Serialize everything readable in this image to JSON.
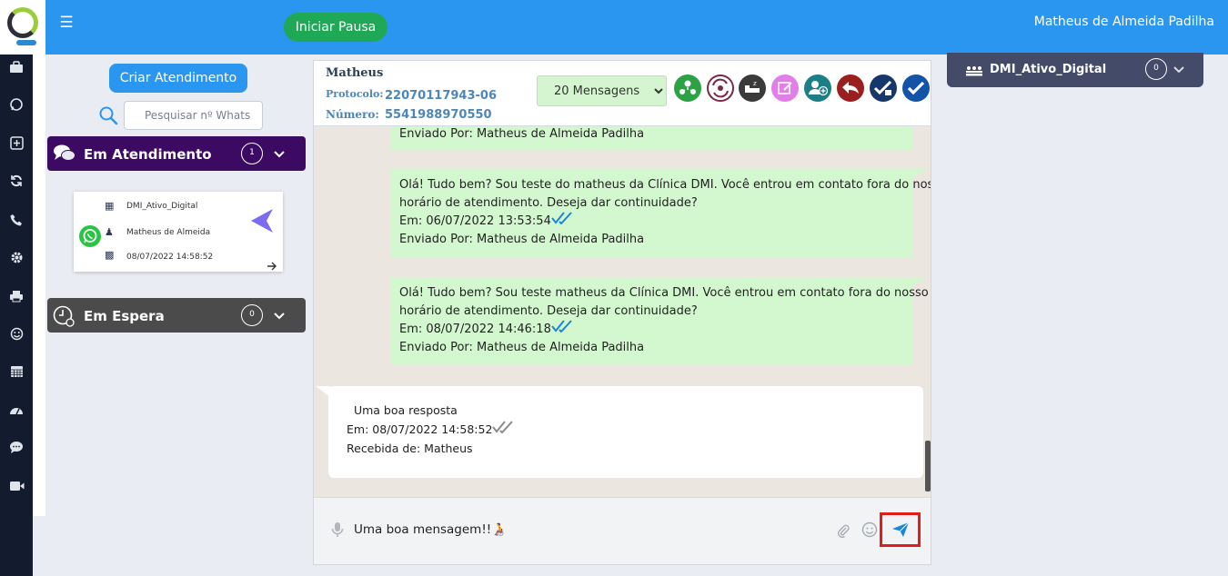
{
  "topbar": {
    "pause_button": "Iniciar Pausa",
    "user_name": "Matheus de Almeida Padilha"
  },
  "left_panel": {
    "create_button": "Criar Atendimento",
    "search_placeholder": "Pesquisar nº Whats",
    "sections": {
      "em_atendimento": {
        "title": "Em Atendimento",
        "count": "1"
      },
      "em_espera": {
        "title": "Em Espera",
        "count": "0"
      }
    },
    "ticket": {
      "queue": "DMI_Ativo_Digital",
      "agent": "Matheus de Almeida",
      "datetime": "08/07/2022 14:58:52"
    }
  },
  "chat": {
    "contact_name": "Matheus",
    "protocol_label": "Protocolo:",
    "protocol": "22070117943-06",
    "number_label": "Número:",
    "number": "5541988970550",
    "messages_select": "20 Mensagens",
    "messages": [
      {
        "direction": "out",
        "lines": [
          "Enviado Por: Matheus de Almeida Padilha"
        ]
      },
      {
        "direction": "out",
        "lines": [
          "  Olá! Tudo bem? Sou teste do matheus da Clínica DMI. Você entrou em contato fora do nosso",
          "horário de atendimento. Deseja dar continuidade?",
          "Em: 06/07/2022 13:53:54",
          "Enviado Por: Matheus de Almeida Padilha"
        ]
      },
      {
        "direction": "out",
        "lines": [
          "  Olá! Tudo bem? Sou teste matheus da Clínica DMI. Você entrou em contato fora do nosso",
          "horário de atendimento. Deseja dar continuidade?",
          "Em: 08/07/2022 14:46:18",
          "Enviado Por: Matheus de Almeida Padilha"
        ]
      },
      {
        "direction": "in",
        "lines": [
          "  Uma boa resposta",
          "Em: 08/07/2022 14:58:52",
          "Recebida de: Matheus"
        ]
      }
    ],
    "composer_value": "Uma boa mensagem!!🧑‍🦽"
  },
  "right_panel": {
    "queue_name": "DMI_Ativo_Digital",
    "queue_count": "0"
  },
  "colors": {
    "topbar": "#2b96ef",
    "rail": "#131b2e",
    "em_atendimento": "#3c0a63",
    "em_espera": "#4b4b4b",
    "pause_button": "#1fa855",
    "outgoing_bubble": "#d3f7cf",
    "queue_card": "#434b69",
    "send_highlight": "#e21b1b"
  },
  "icons": {
    "rail": [
      "briefcase-icon",
      "whatsapp-icon",
      "plus-square-icon",
      "refresh-icon",
      "phone-icon",
      "gear-icon",
      "printer-icon",
      "smiley-icon",
      "calendar-icon",
      "dashboard-icon",
      "chat-icon",
      "video-icon"
    ],
    "chat_actions": [
      "transfer-group-icon",
      "transfer-icon",
      "sleep-icon",
      "edit-icon",
      "add-user-icon",
      "return-icon",
      "finish-check-icon",
      "check-icon"
    ]
  }
}
